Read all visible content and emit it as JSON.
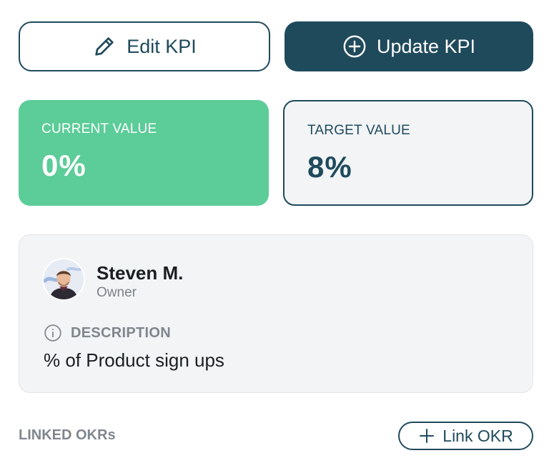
{
  "actions": {
    "edit_label": "Edit KPI",
    "update_label": "Update KPI",
    "edit_icon": "pencil-icon",
    "update_icon": "plus-circle-icon"
  },
  "current": {
    "label": "CURRENT VALUE",
    "value": "0%",
    "color": "#5ccc98"
  },
  "target": {
    "label": "TARGET VALUE",
    "value": "8%",
    "color": "#1f4a5c"
  },
  "owner": {
    "name": "Steven M.",
    "role": "Owner",
    "avatar_icon": "user-avatar"
  },
  "description": {
    "label": "DESCRIPTION",
    "text": "% of Product sign ups",
    "icon": "info-icon"
  },
  "linked_okrs": {
    "label": "LINKED OKRs",
    "link_button_label": "Link OKR",
    "link_icon": "plus-icon"
  },
  "colors": {
    "primary": "#1f4a5c",
    "success": "#5ccc98",
    "muted": "#80868d",
    "panel": "#f3f4f6"
  }
}
